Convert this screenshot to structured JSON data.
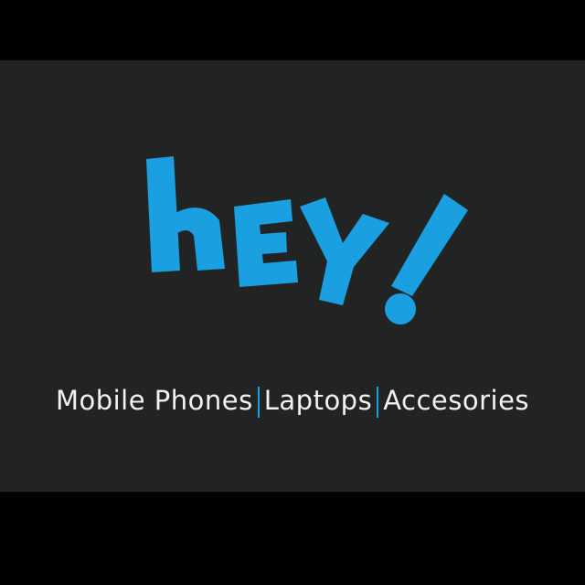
{
  "logo": {
    "wordmark": "hEY!",
    "color": "#1a9fe0"
  },
  "tagline": {
    "items": [
      "Mobile Phones",
      "Laptops",
      "Accesories"
    ],
    "separator_color": "#1a9fe0",
    "text_color": "#f2f2f2"
  },
  "colors": {
    "background": "#000000",
    "panel": "#222424"
  }
}
